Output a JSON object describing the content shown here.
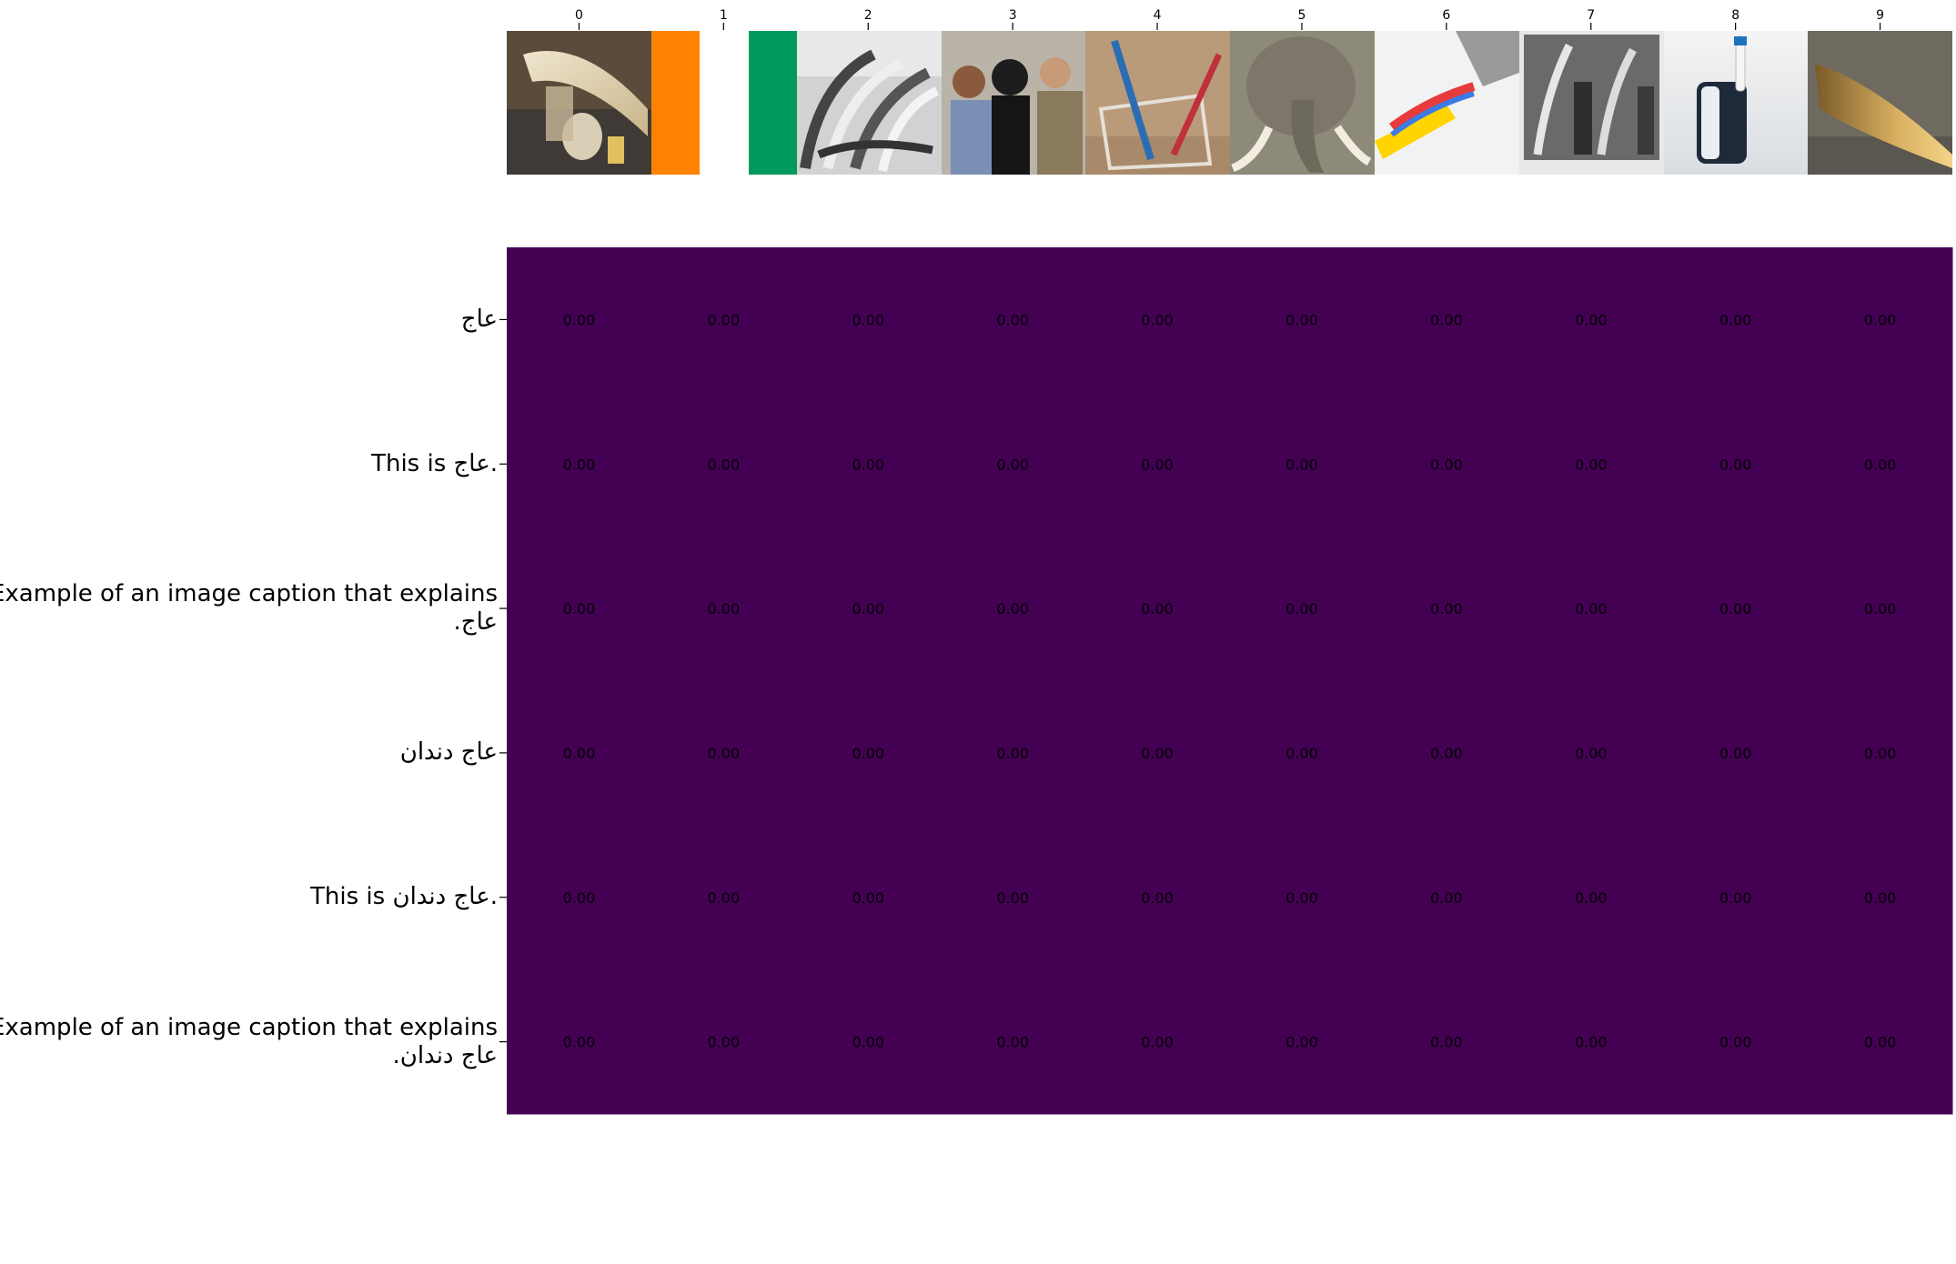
{
  "chart_data": {
    "type": "heatmap",
    "title": "",
    "xlabel": "",
    "ylabel": "",
    "x_tick_labels": [
      "0",
      "1",
      "2",
      "3",
      "4",
      "5",
      "6",
      "7",
      "8",
      "9"
    ],
    "x_tick_position": "top",
    "column_thumbnails": [
      "carved ivory tusk in museum display case",
      "flag with orange stripe",
      "flag with green stripe",
      "black-and-white stacked elephant tusks",
      "people brushing teeth",
      "toothbrushes in holder",
      "elephant face with tusks",
      "toothpaste on toothbrush",
      "vintage photo of men with tusks",
      "electric toothbrush",
      "carved ivory horn"
    ],
    "rows": [
      {
        "label_lines": [
          "عاج"
        ]
      },
      {
        "label_lines": [
          "This is عاج."
        ]
      },
      {
        "label_lines": [
          "Example of an image caption that explains",
          "عاج."
        ]
      },
      {
        "label_lines": [
          "عاج دندان"
        ]
      },
      {
        "label_lines": [
          "This is عاج دندان."
        ]
      },
      {
        "label_lines": [
          "Example of an image caption that explains",
          "عاج دندان."
        ]
      }
    ],
    "values": [
      [
        0,
        0,
        0,
        0,
        0,
        0,
        0,
        0,
        0,
        0
      ],
      [
        0,
        0,
        0,
        0,
        0,
        0,
        0,
        0,
        0,
        0
      ],
      [
        0,
        0,
        0,
        0,
        0,
        0,
        0,
        0,
        0,
        0
      ],
      [
        0,
        0,
        0,
        0,
        0,
        0,
        0,
        0,
        0,
        0
      ],
      [
        0,
        0,
        0,
        0,
        0,
        0,
        0,
        0,
        0,
        0
      ],
      [
        0,
        0,
        0,
        0,
        0,
        0,
        0,
        0,
        0,
        0
      ]
    ],
    "value_format": "0.00",
    "colormap": "viridis",
    "cell_color": "#440154",
    "annotation_color": "#000000",
    "legend": "none"
  }
}
